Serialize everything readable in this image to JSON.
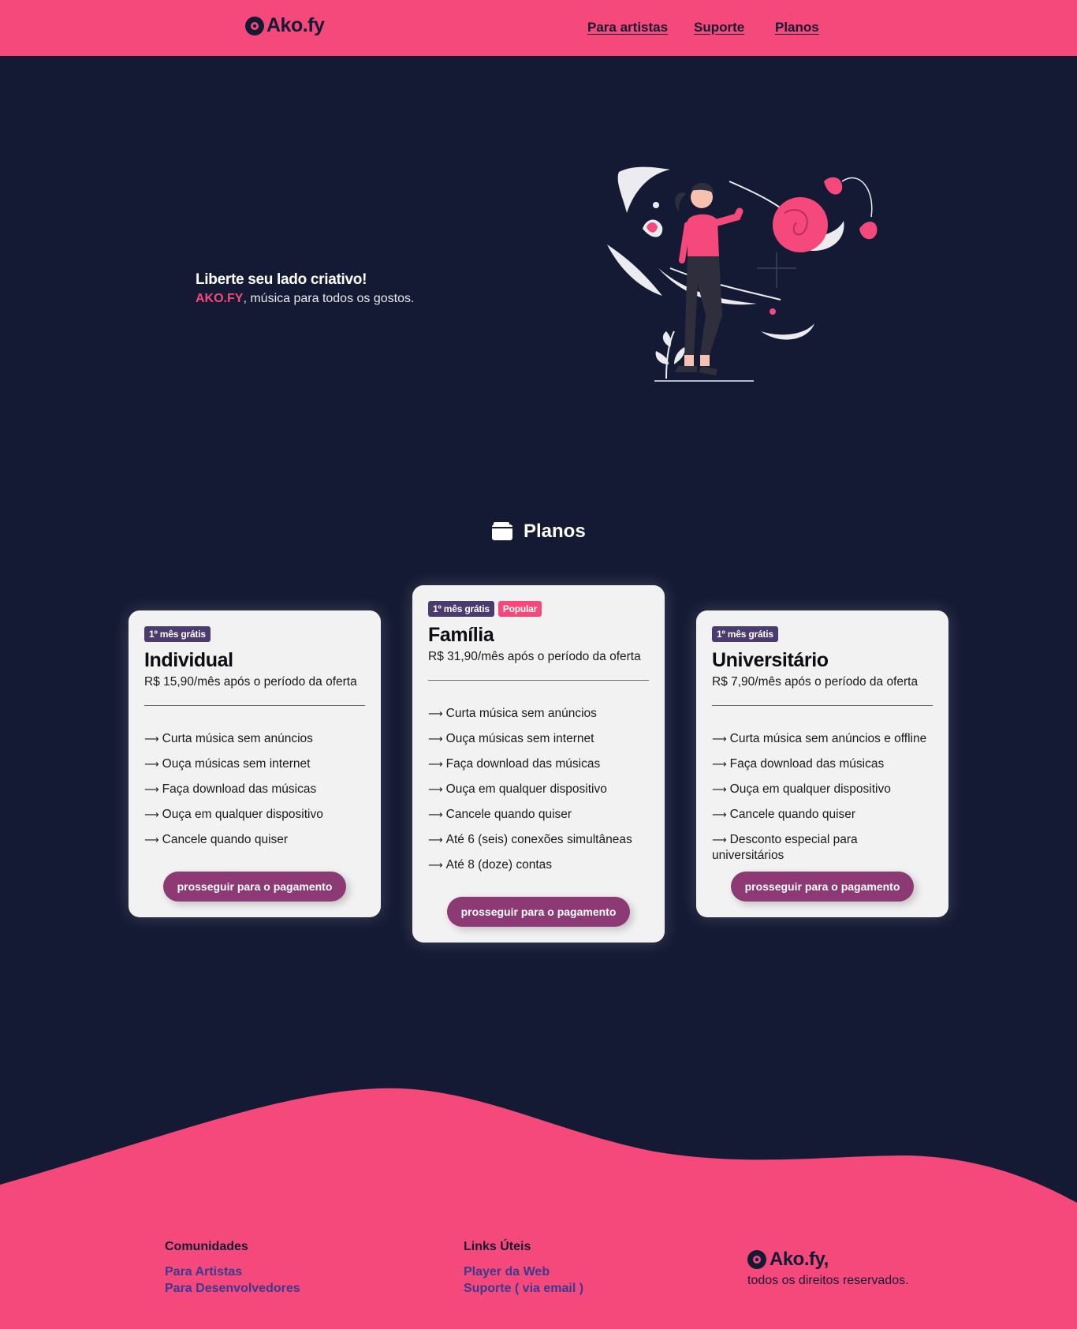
{
  "header": {
    "brand": "Ako.fy",
    "nav": {
      "artists": "Para artistas",
      "support": "Suporte",
      "plans": "Planos"
    }
  },
  "hero": {
    "title": "Liberte seu lado criativo!",
    "brand": "AKO.FY",
    "subtitle": ", música para todos os gostos."
  },
  "plans_section": {
    "title": "Planos"
  },
  "plans": [
    {
      "badge": "1º mês grátis",
      "name": "Individual",
      "price": "R$ 15,90/mês após o período da oferta",
      "features": [
        "Curta música sem anúncios",
        "Ouça músicas sem internet",
        "Faça download das músicas",
        "Ouça em qualquer dispositivo",
        "Cancele quando quiser"
      ],
      "button": "prosseguir para o pagamento"
    },
    {
      "badge": "1º mês grátis",
      "popular_badge": "Popular",
      "name": "Família",
      "price": "R$ 31,90/mês após o período da oferta",
      "features": [
        "Curta música sem anúncios",
        "Ouça músicas sem internet",
        "Faça download das músicas",
        "Ouça em qualquer dispositivo",
        "Cancele quando quiser",
        "Até 6 (seis) conexões simultâneas",
        "Até 8 (doze) contas"
      ],
      "button": "prosseguir para o pagamento"
    },
    {
      "badge": "1º mês grátis",
      "name": "Universitário",
      "price": "R$ 7,90/mês após o período da oferta",
      "features": [
        "Curta música sem anúncios e offline",
        "Faça download das músicas",
        "Ouça em qualquer dispositivo",
        "Cancele quando quiser",
        "Desconto especial para universitários"
      ],
      "button": "prosseguir para o pagamento"
    }
  ],
  "footer": {
    "communities": {
      "title": "Comunidades",
      "links": [
        "Para Artistas",
        "Para Desenvolvedores"
      ]
    },
    "useful_links": {
      "title": "Links Úteis",
      "links": [
        "Player da Web",
        "Suporte ( via email )"
      ]
    },
    "brand": "Ako.fy,",
    "rights": "todos os direitos reservados."
  },
  "colors": {
    "brand_pink": "#f5497c",
    "background_navy": "#141a33",
    "button_purple": "#8d3a74",
    "badge_purple": "#4b3b6e",
    "footer_link": "#3b3a8f"
  },
  "icons": {
    "logo": "vinyl-record-icon",
    "plans": "wallet-icon",
    "feature_bullet": "arrow-right-icon"
  }
}
